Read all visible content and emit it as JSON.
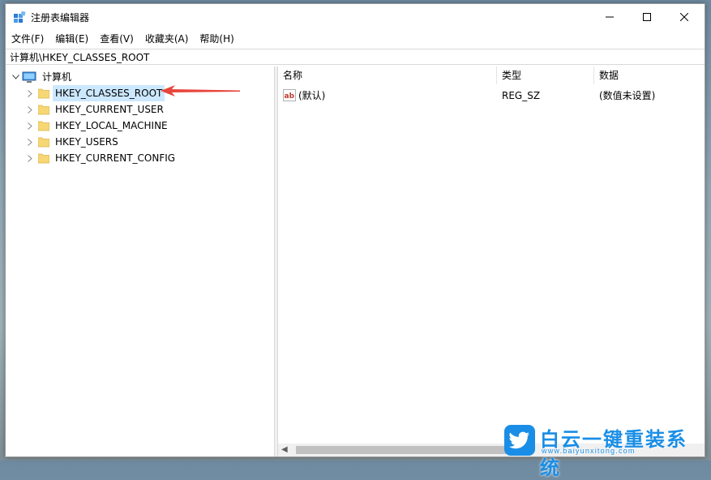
{
  "window": {
    "title": "注册表编辑器"
  },
  "menu": [
    "文件(F)",
    "编辑(E)",
    "查看(V)",
    "收藏夹(A)",
    "帮助(H)"
  ],
  "address": "计算机\\HKEY_CLASSES_ROOT",
  "tree": {
    "root": "计算机",
    "children": [
      {
        "label": "HKEY_CLASSES_ROOT",
        "selected": true
      },
      {
        "label": "HKEY_CURRENT_USER"
      },
      {
        "label": "HKEY_LOCAL_MACHINE"
      },
      {
        "label": "HKEY_USERS"
      },
      {
        "label": "HKEY_CURRENT_CONFIG"
      }
    ]
  },
  "list": {
    "columns": [
      "名称",
      "类型",
      "数据"
    ],
    "rows": [
      {
        "icon": "ab",
        "name": "(默认)",
        "type": "REG_SZ",
        "data": "(数值未设置)"
      }
    ]
  },
  "watermark": {
    "title": "白云一键重装系统",
    "url": "www.baiyunxitong.com"
  },
  "colors": {
    "selection": "#cce8ff",
    "annotation_arrow": "#e8453c",
    "watermark": "#1a8ee6"
  }
}
